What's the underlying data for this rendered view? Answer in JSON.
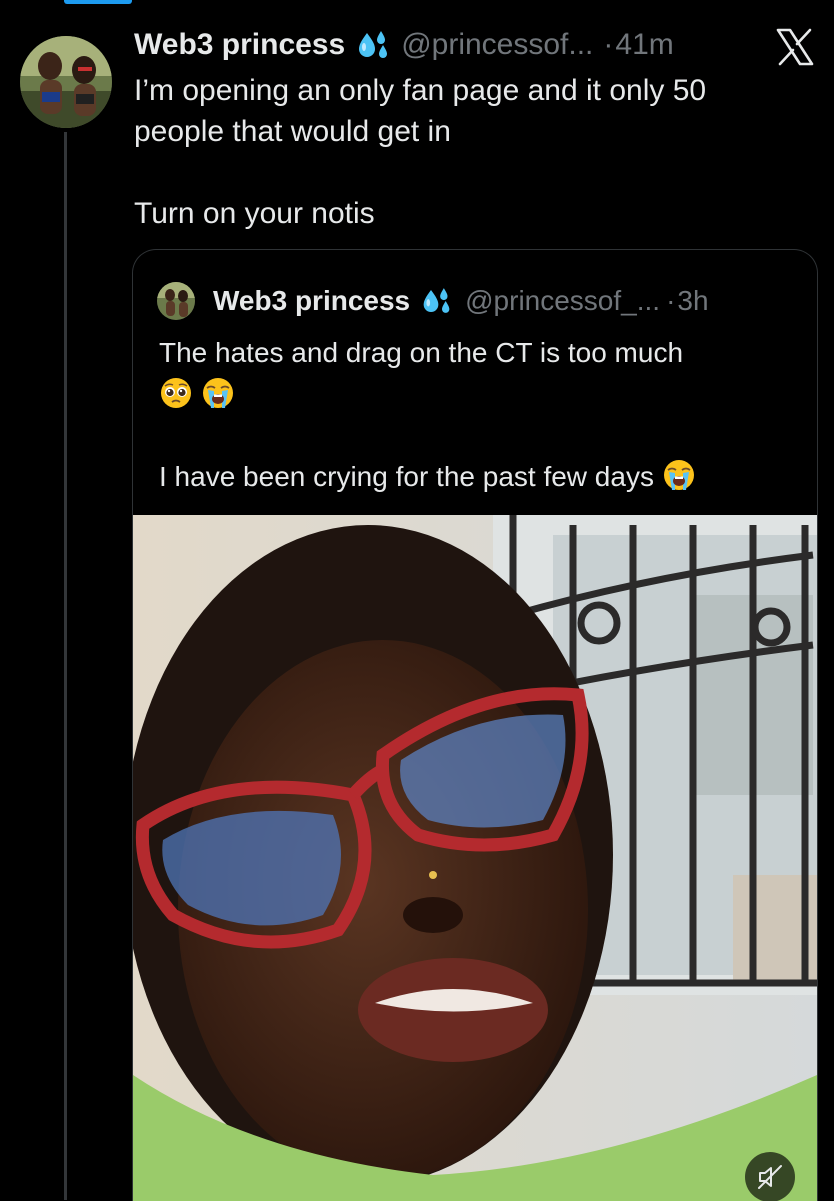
{
  "tweet": {
    "author_name": "Web3 princess",
    "author_badge_emoji": "💦",
    "handle": "@princessof...",
    "separator": "·",
    "time": "41m",
    "text_lines": [
      "I’m opening an only fan page and it only 50",
      "people that would get in",
      "Turn on your notis"
    ]
  },
  "quoted_tweet": {
    "author_name": "Web3 princess",
    "author_badge_emoji": "💦",
    "handle": "@princessof_...",
    "separator": "·",
    "time": "3h",
    "text_line_1": "The hates and drag on the CT is too much",
    "text_line_3": "I have been crying for the past few days",
    "emojis_line_2": [
      "pleading-face",
      "loudly-crying-face"
    ],
    "emoji_line_3": "loudly-crying-face"
  },
  "media": {
    "type": "video",
    "audio_state": "muted"
  },
  "icons": {
    "platform_logo": "x-logo-icon",
    "mute": "speaker-muted-icon",
    "badge": "sweat-droplets-icon"
  },
  "colors": {
    "background": "#000000",
    "primary_text": "#e7e9ea",
    "secondary_text": "#71767b",
    "border": "#2f3336",
    "accent": "#1d9bf0"
  }
}
